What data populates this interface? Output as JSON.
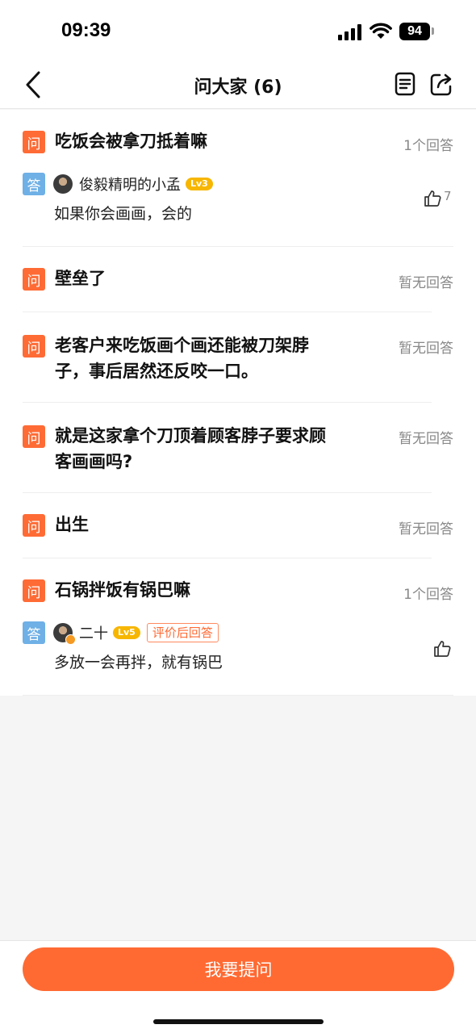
{
  "status_bar": {
    "time": "09:39",
    "battery": "94"
  },
  "nav": {
    "title": "问大家 (6)",
    "icons": [
      "back-icon",
      "document-icon",
      "share-icon"
    ]
  },
  "labels": {
    "question_badge": "问",
    "answer_badge": "答"
  },
  "questions": [
    {
      "text": "吃饭会被拿刀抵着嘛",
      "count": "1个回答",
      "answer": {
        "user": "俊毅精明的小孟",
        "level": "Lv3",
        "text": "如果你会画画，会的",
        "likes": "7"
      }
    },
    {
      "text": "壁垒了",
      "count": "暂无回答"
    },
    {
      "text": "老客户来吃饭画个画还能被刀架脖子，事后居然还反咬一口。",
      "line1": "老客户来吃饭画个画还能被刀架脖",
      "line2": "子，事后居然还反咬一口。",
      "count": "暂无回答"
    },
    {
      "text": "就是这家拿个刀顶着顾客脖子要求顾客画画吗?",
      "line1": "就是这家拿个刀顶着顾客脖子要求顾",
      "line2": "客画画吗?",
      "count": "暂无回答"
    },
    {
      "text": "出生",
      "count": "暂无回答"
    },
    {
      "text": "石锅拌饭有锅巴嘛",
      "count": "1个回答",
      "answer": {
        "user": "二十",
        "level": "Lv5",
        "tag": "评价后回答",
        "text": "多放一会再拌，就有锅巴",
        "likes": ""
      }
    }
  ],
  "footer": {
    "ask_button": "我要提问"
  },
  "colors": {
    "accent": "#ff6a33",
    "question_badge": "#ff6b35",
    "answer_badge": "#6fb0e6",
    "level_badge": "#f7b600"
  }
}
